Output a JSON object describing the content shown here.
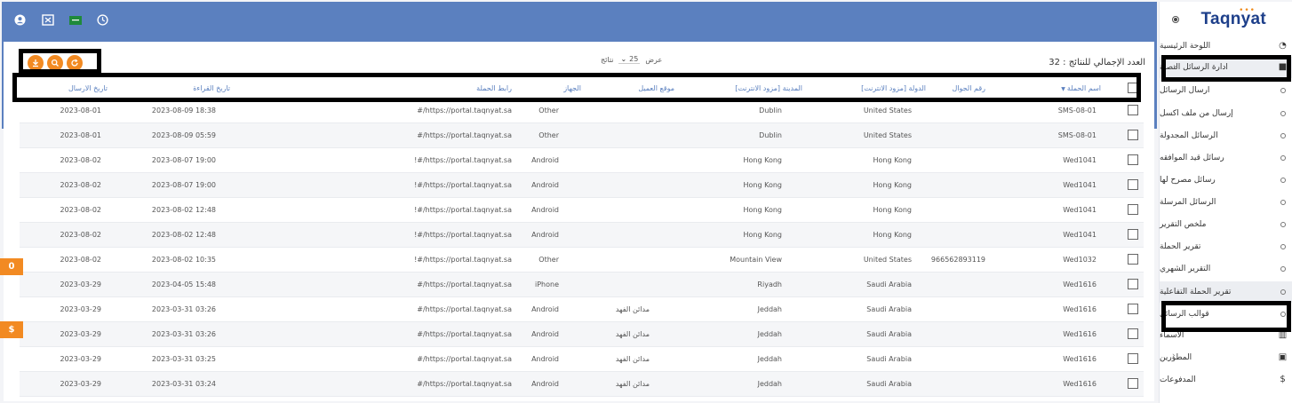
{
  "brand": {
    "logo_text": "Taqnyat",
    "accent": "#f28a22",
    "header_color": "#5b80bf"
  },
  "topbar": {
    "icons": [
      "user-icon",
      "expand-icon",
      "flag-icon",
      "clock-icon"
    ]
  },
  "sidebar": {
    "items": [
      {
        "label": "اللوحة الرئيسية",
        "icon": "dashboard-icon"
      },
      {
        "label": "ادارة الرسائل النصية",
        "icon": "message-icon"
      },
      {
        "label": "ارسال الرسائل"
      },
      {
        "label": "إرسال من ملف اكسل"
      },
      {
        "label": "الرسائل المجدولة"
      },
      {
        "label": "رسائل قيد الموافقه"
      },
      {
        "label": "رسائل مصرح لها"
      },
      {
        "label": "الرسائل المرسلة"
      },
      {
        "label": "ملخص التقرير"
      },
      {
        "label": "تقرير الحملة"
      },
      {
        "label": "التقرير الشهري"
      },
      {
        "label": "تقرير الحملة التفاعلية"
      },
      {
        "label": "قوالب الرسائل"
      },
      {
        "label": "الاسماء",
        "icon": "book-icon"
      },
      {
        "label": "المطورين",
        "icon": "code-icon"
      },
      {
        "label": "المدفوعات",
        "icon": "dollar-icon"
      }
    ]
  },
  "toolbar": {
    "total_label": "العدد الإجمالي للنتائج : 32",
    "show_label": "عرض",
    "page_size": "25",
    "results_label": "نتائج"
  },
  "table": {
    "headers": {
      "name": "اسم الحملة",
      "mobile": "رقم الجوال",
      "country": "الدولة [مزود الانترنت]",
      "city": "المدينة [مزود الانترنت]",
      "location": "موقع العميل",
      "device": "الجهاز",
      "link": "رابط الحملة",
      "read_date": "تاريخ القراءة",
      "send_date": "تاريخ الارسال"
    },
    "rows": [
      {
        "name": "SMS-08-01",
        "mobile": "",
        "country": "United States",
        "city": "Dublin",
        "location": "",
        "device": "Other",
        "link": "#/https://portal.taqnyat.sa",
        "read_date": "2023-08-09 18:38",
        "send_date": "2023-08-01"
      },
      {
        "name": "SMS-08-01",
        "mobile": "",
        "country": "United States",
        "city": "Dublin",
        "location": "",
        "device": "Other",
        "link": "#/https://portal.taqnyat.sa",
        "read_date": "2023-08-09 05:59",
        "send_date": "2023-08-01"
      },
      {
        "name": "Wed1041",
        "mobile": "",
        "country": "Hong Kong",
        "city": "Hong Kong",
        "location": "",
        "device": "Android",
        "link": "!#/https://portal.taqnyat.sa",
        "read_date": "2023-08-07 19:00",
        "send_date": "2023-08-02"
      },
      {
        "name": "Wed1041",
        "mobile": "",
        "country": "Hong Kong",
        "city": "Hong Kong",
        "location": "",
        "device": "Android",
        "link": "!#/https://portal.taqnyat.sa",
        "read_date": "2023-08-07 19:00",
        "send_date": "2023-08-02"
      },
      {
        "name": "Wed1041",
        "mobile": "",
        "country": "Hong Kong",
        "city": "Hong Kong",
        "location": "",
        "device": "Android",
        "link": "!#/https://portal.taqnyat.sa",
        "read_date": "2023-08-02 12:48",
        "send_date": "2023-08-02"
      },
      {
        "name": "Wed1041",
        "mobile": "",
        "country": "Hong Kong",
        "city": "Hong Kong",
        "location": "",
        "device": "Android",
        "link": "!#/https://portal.taqnyat.sa",
        "read_date": "2023-08-02 12:48",
        "send_date": "2023-08-02"
      },
      {
        "name": "Wed1032",
        "mobile": "966562893119",
        "country": "United States",
        "city": "Mountain View",
        "location": "",
        "device": "Other",
        "link": "!#/https://portal.taqnyat.sa",
        "read_date": "2023-08-02 10:35",
        "send_date": "2023-08-02"
      },
      {
        "name": "Wed1616",
        "mobile": "",
        "country": "Saudi Arabia",
        "city": "Riyadh",
        "location": "",
        "device": "iPhone",
        "link": "#/https://portal.taqnyat.sa",
        "read_date": "2023-04-05 15:48",
        "send_date": "2023-03-29"
      },
      {
        "name": "Wed1616",
        "mobile": "",
        "country": "Saudi Arabia",
        "city": "Jeddah",
        "location": "مدائن الفهد",
        "device": "Android",
        "link": "#/https://portal.taqnyat.sa",
        "read_date": "2023-03-31 03:26",
        "send_date": "2023-03-29"
      },
      {
        "name": "Wed1616",
        "mobile": "",
        "country": "Saudi Arabia",
        "city": "Jeddah",
        "location": "مدائن الفهد",
        "device": "Android",
        "link": "#/https://portal.taqnyat.sa",
        "read_date": "2023-03-31 03:26",
        "send_date": "2023-03-29"
      },
      {
        "name": "Wed1616",
        "mobile": "",
        "country": "Saudi Arabia",
        "city": "Jeddah",
        "location": "مدائن الفهد",
        "device": "Android",
        "link": "#/https://portal.taqnyat.sa",
        "read_date": "2023-03-31 03:25",
        "send_date": "2023-03-29"
      },
      {
        "name": "Wed1616",
        "mobile": "",
        "country": "Saudi Arabia",
        "city": "Jeddah",
        "location": "مدائن الفهد",
        "device": "Android",
        "link": "#/https://portal.taqnyat.sa",
        "read_date": "2023-03-31 03:24",
        "send_date": "2023-03-29"
      }
    ]
  },
  "side_tabs": {
    "accessibility_icon": "accessibility-icon",
    "dollar_label": "$"
  }
}
